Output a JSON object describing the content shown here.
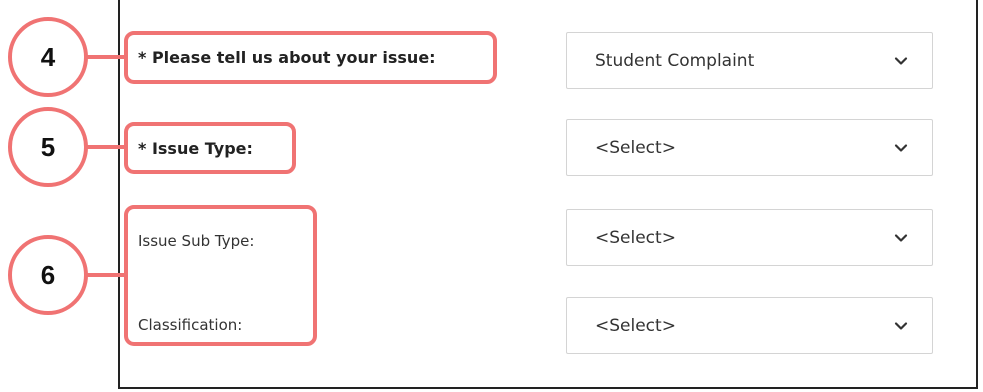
{
  "form": {
    "fields": [
      {
        "label": "* Please tell us about your issue:",
        "value": "Student Complaint",
        "required": true
      },
      {
        "label": "* Issue Type:",
        "value": "<Select>",
        "required": true
      },
      {
        "label": "Issue Sub Type:",
        "value": "<Select>",
        "required": false
      },
      {
        "label": "Classification:",
        "value": "<Select>",
        "required": false
      }
    ]
  },
  "annotations": {
    "callouts": [
      "4",
      "5",
      "6"
    ],
    "color": "#f07373"
  },
  "icons": {
    "dropdown": "chevron-down-icon"
  }
}
